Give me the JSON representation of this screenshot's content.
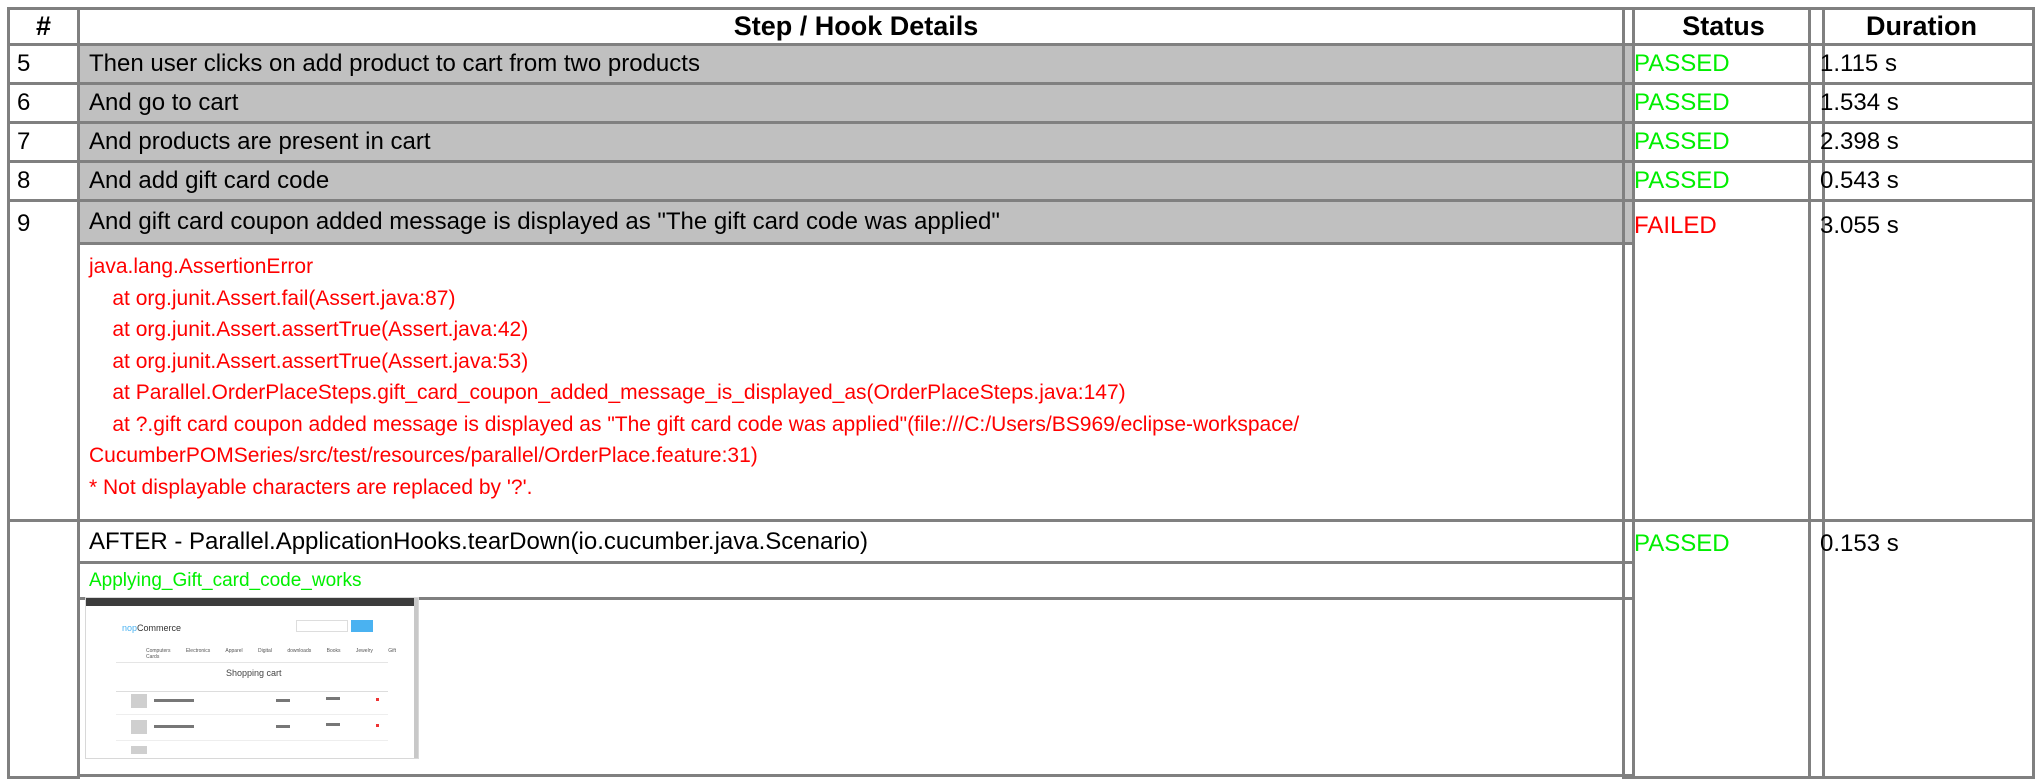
{
  "headers": {
    "num": "#",
    "details": "Step / Hook Details",
    "status": "Status",
    "duration": "Duration"
  },
  "steps": [
    {
      "num": "5",
      "text": "Then user clicks on add product to cart from two products",
      "status": "PASSED",
      "duration": "1.115 s"
    },
    {
      "num": "6",
      "text": "And go to cart",
      "status": "PASSED",
      "duration": "1.534 s"
    },
    {
      "num": "7",
      "text": "And products are present in cart",
      "status": "PASSED",
      "duration": "2.398 s"
    },
    {
      "num": "8",
      "text": "And add gift card code",
      "status": "PASSED",
      "duration": "0.543 s"
    },
    {
      "num": "9",
      "text": "And gift card coupon added message is displayed as \"The gift card code was applied\"",
      "status": "FAILED",
      "duration": "3.055 s"
    }
  ],
  "error_lines": [
    "java.lang.AssertionError",
    "    at org.junit.Assert.fail(Assert.java:87)",
    "    at org.junit.Assert.assertTrue(Assert.java:42)",
    "    at org.junit.Assert.assertTrue(Assert.java:53)",
    "    at Parallel.OrderPlaceSteps.gift_card_coupon_added_message_is_displayed_as(OrderPlaceSteps.java:147)",
    "    at ?.gift card coupon added message is displayed as \"The gift card code was applied\"(file:///C:/Users/BS969/eclipse-workspace/",
    "CucumberPOMSeries/src/test/resources/parallel/OrderPlace.feature:31)",
    "* Not displayable characters are replaced by '?'."
  ],
  "hook": {
    "text": "AFTER - Parallel.ApplicationHooks.tearDown(io.cucumber.java.Scenario)",
    "status": "PASSED",
    "duration": "0.153 s",
    "embedding_name": "Applying_Gift_card_code_works"
  },
  "thumbnail": {
    "logo_prefix": "nop",
    "logo_suffix": "Commerce",
    "nav": "Computers Electronics Apparel Digital downloads Books Jewelry Gift Cards",
    "title": "Shopping cart",
    "icon": "screenshot-thumbnail-icon"
  },
  "colors": {
    "passed": "#00ee00",
    "failed": "#ff0000",
    "step_bg": "#c0c0c0",
    "border": "#808080"
  }
}
